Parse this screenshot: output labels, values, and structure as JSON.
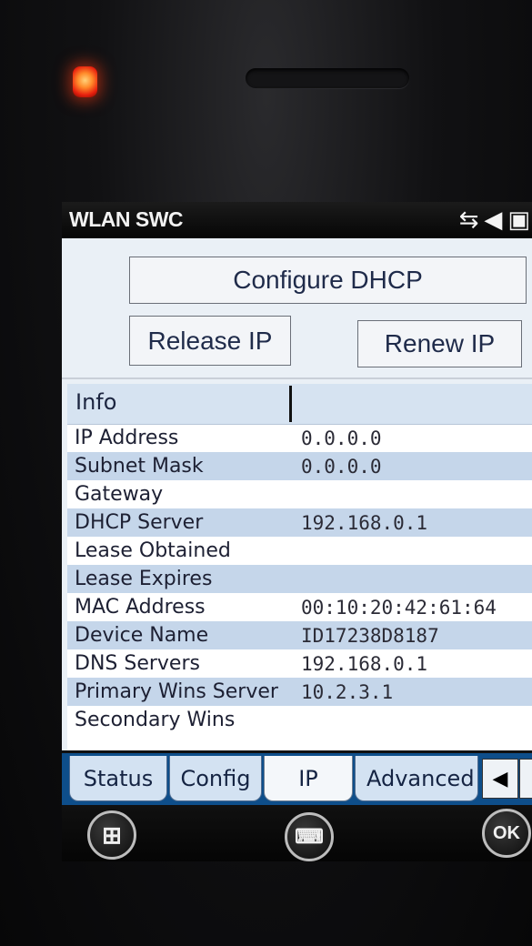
{
  "window": {
    "title": "WLAN SWC"
  },
  "status_icons": [
    "connectivity-icon",
    "volume-muted-icon",
    "battery-icon"
  ],
  "buttons": {
    "configure_dhcp": "Configure DHCP",
    "release_ip": "Release IP",
    "renew_ip": "Renew IP"
  },
  "info": {
    "header": "Info",
    "rows": [
      {
        "label": "IP Address",
        "value": "0.0.0.0"
      },
      {
        "label": "Subnet Mask",
        "value": "0.0.0.0"
      },
      {
        "label": "Gateway",
        "value": ""
      },
      {
        "label": "DHCP Server",
        "value": "192.168.0.1"
      },
      {
        "label": "Lease Obtained",
        "value": ""
      },
      {
        "label": "Lease Expires",
        "value": ""
      },
      {
        "label": "MAC Address",
        "value": "00:10:20:42:61:64"
      },
      {
        "label": "Device Name",
        "value": "ID17238D8187"
      },
      {
        "label": "DNS Servers",
        "value": "192.168.0.1"
      },
      {
        "label": "Primary Wins Server",
        "value": "10.2.3.1"
      },
      {
        "label": "Secondary Wins",
        "value": ""
      }
    ]
  },
  "tabs": [
    {
      "label": "Status",
      "active": false
    },
    {
      "label": "Config",
      "active": false
    },
    {
      "label": "IP",
      "active": true
    },
    {
      "label": "Advanced",
      "active": false
    }
  ],
  "softkeys": {
    "start": "⊞",
    "keyboard": "⌨",
    "ok": "OK"
  },
  "colors": {
    "accent": "#0e4e8a",
    "row_alt": "#c5d6ea",
    "header": "#d6e3f1"
  }
}
